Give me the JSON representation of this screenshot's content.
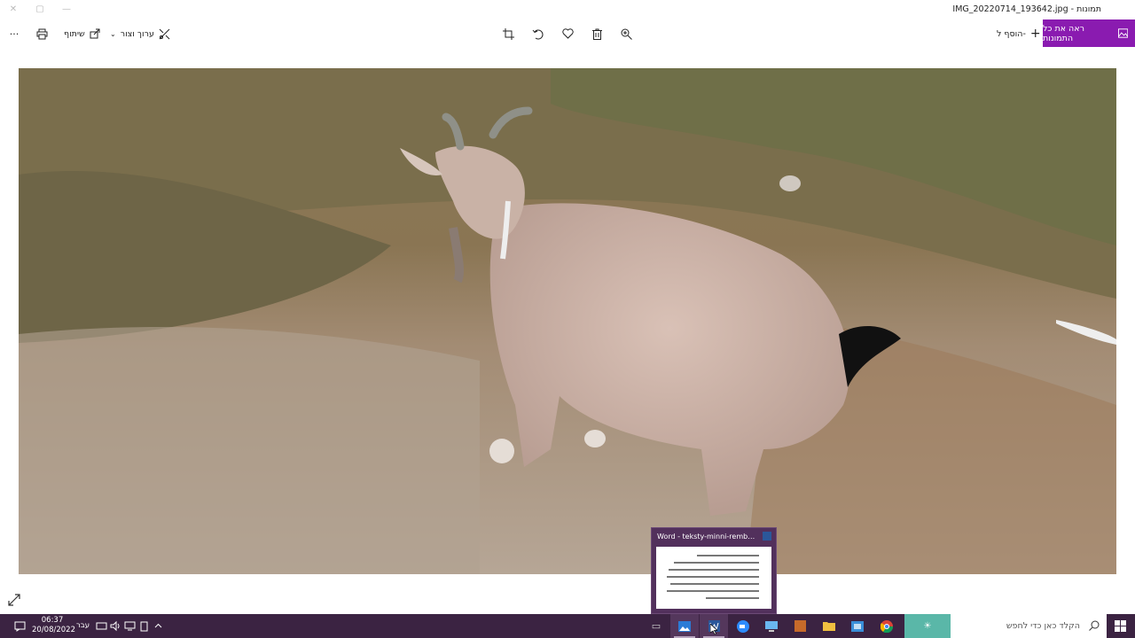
{
  "window": {
    "title": "IMG_20220714_193642.jpg - תמונות"
  },
  "toolbar": {
    "see_all_label": "ראה את כל התמונות",
    "add_to_label": "הוסף ל-",
    "edit_create_label": "ערוך וצור",
    "share_label": "שיתוף",
    "more_label": "···"
  },
  "taskbar": {
    "search_placeholder": "הקלד כאן כדי לחפש",
    "time": "06:37",
    "date": "20/08/2022",
    "language": "עבר"
  },
  "preview": {
    "title": "Word - teksty-minni-rembo [n..."
  },
  "colors": {
    "accent": "#8a1bb0",
    "taskbar": "#3b2342"
  },
  "icons": {
    "crop": "crop-icon",
    "rotate": "rotate-icon",
    "favorite": "heart-icon",
    "delete": "trash-icon",
    "zoom": "zoom-in-icon",
    "print": "print-icon"
  }
}
